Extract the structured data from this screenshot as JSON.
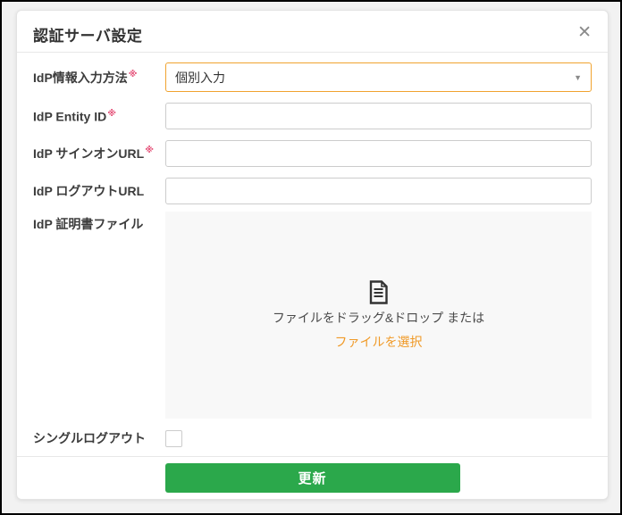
{
  "header": {
    "title": "認証サーバ設定",
    "close_glyph": "✕"
  },
  "icons": {
    "caret_down": "▼"
  },
  "required_mark": "※",
  "fields": {
    "input_method": {
      "label": "IdP情報入力方法",
      "value": "個別入力",
      "required": true
    },
    "entity_id": {
      "label": "IdP Entity ID",
      "value": "",
      "placeholder": "",
      "required": true
    },
    "signon_url": {
      "label": "IdP サインオンURL",
      "value": "",
      "placeholder": "",
      "required": true
    },
    "logout_url": {
      "label": "IdP ログアウトURL",
      "value": "",
      "placeholder": "",
      "required": false
    },
    "certificate": {
      "label": "IdP 証明書ファイル",
      "drop_text": "ファイルをドラッグ&ドロップ または",
      "select_link": "ファイルを選択"
    },
    "single_logout": {
      "label": "シングルログアウト",
      "checked": false
    }
  },
  "footer": {
    "submit_label": "更新"
  },
  "colors": {
    "accent_orange": "#f0a32f",
    "link_orange": "#f09a28",
    "button_green": "#2ba84b",
    "required_pink": "#e5537a"
  }
}
